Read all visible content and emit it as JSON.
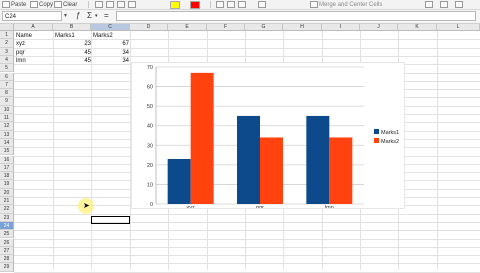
{
  "toolbar": {
    "paste_label": "Paste",
    "copy_label": "Copy",
    "clear_label": "Clear",
    "merge_label": "Merge and Center Cells",
    "fill_color": "#ffff00",
    "font_color": "#ff0000"
  },
  "formula_bar": {
    "cell_ref": "C24",
    "sum_glyph": "Σ",
    "equals_glyph": "=",
    "content": ""
  },
  "grid": {
    "columns": [
      "A",
      "B",
      "C",
      "D",
      "E",
      "F",
      "G",
      "H",
      "I",
      "J",
      "K",
      "L"
    ],
    "active_column": "C",
    "rows": [
      "1",
      "2",
      "3",
      "4",
      "5",
      "6",
      "7",
      "8",
      "9",
      "10",
      "11",
      "12",
      "13",
      "14",
      "15",
      "16",
      "17",
      "18",
      "19",
      "20",
      "21",
      "22",
      "23",
      "24",
      "25",
      "26",
      "27",
      "28",
      "29"
    ],
    "active_row": "24",
    "cells": {
      "a1": "Name",
      "b1": "Marks1",
      "c1": "Marks2",
      "a2": "xyz",
      "b2": "23",
      "c2": "67",
      "a3": "pqr",
      "b3": "45",
      "c3": "34",
      "a4": "lmn",
      "b4": "45",
      "c4": "34"
    }
  },
  "chart_data": {
    "type": "bar",
    "categories": [
      "xyz",
      "pqr",
      "lmn"
    ],
    "series": [
      {
        "name": "Marks1",
        "values": [
          23,
          45,
          45
        ],
        "color": "#0d4a8c"
      },
      {
        "name": "Marks2",
        "values": [
          67,
          34,
          34
        ],
        "color": "#ff420e"
      }
    ],
    "ylim": [
      0,
      70
    ],
    "yticks": [
      0,
      10,
      20,
      30,
      40,
      50,
      60,
      70
    ],
    "yticks_labels": [
      "0",
      "10",
      "20",
      "30",
      "40",
      "50",
      "60",
      "70"
    ],
    "grid": true,
    "legend": "right",
    "title": "",
    "xlabel": "",
    "ylabel": ""
  }
}
